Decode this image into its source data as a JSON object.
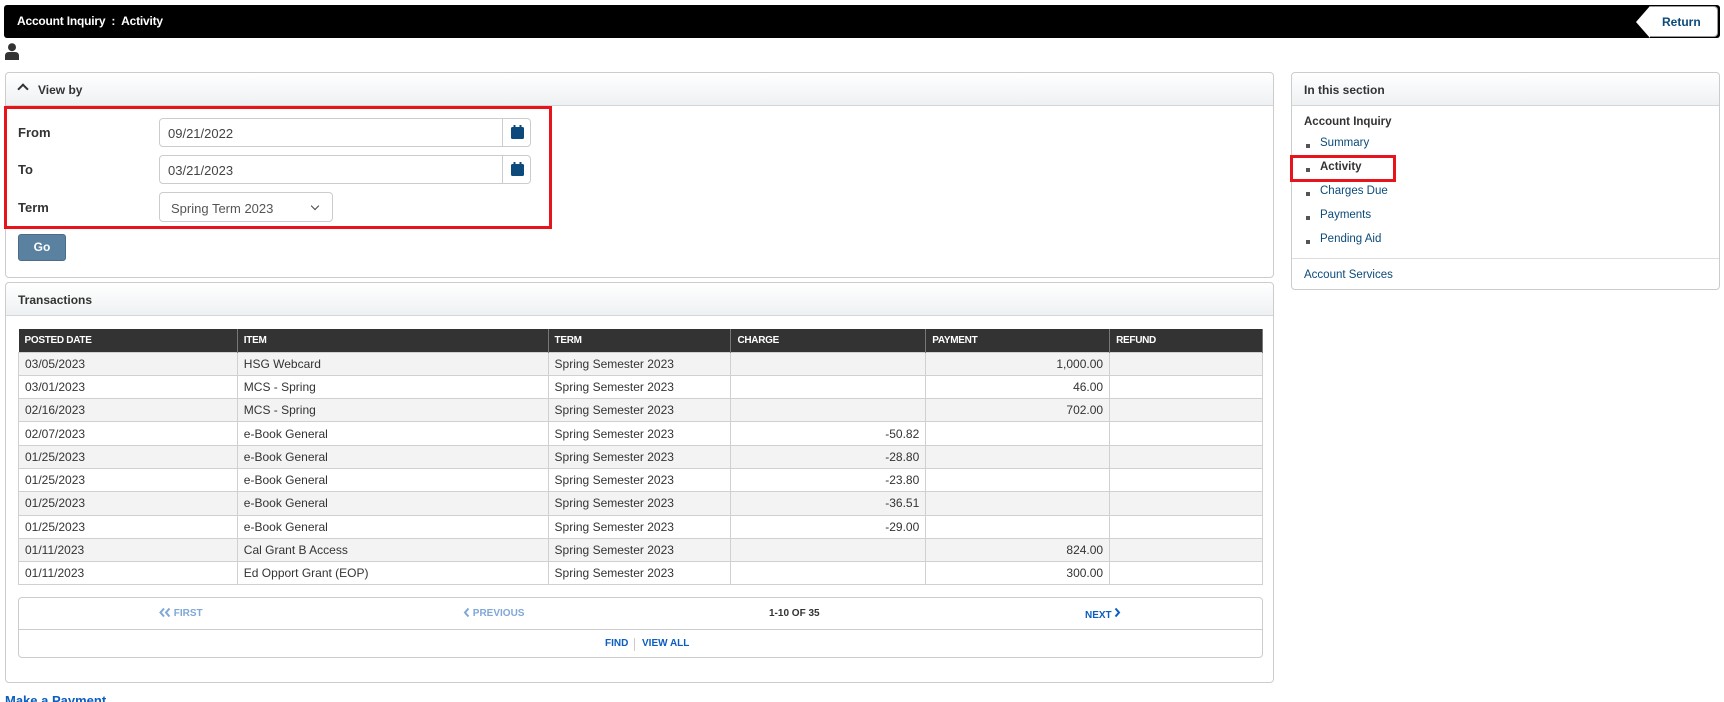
{
  "header": {
    "breadcrumb": [
      "Account Inquiry",
      "Activity"
    ],
    "separator": ":",
    "return_label": "Return"
  },
  "view_by": {
    "title": "View by",
    "from_label": "From",
    "from_value": "09/21/2022",
    "to_label": "To",
    "to_value": "03/21/2023",
    "term_label": "Term",
    "term_value": "Spring Term 2023",
    "go_label": "Go"
  },
  "transactions": {
    "title": "Transactions",
    "columns": [
      "POSTED DATE",
      "ITEM",
      "TERM",
      "CHARGE",
      "PAYMENT",
      "REFUND"
    ],
    "rows": [
      {
        "date": "03/05/2023",
        "item": "HSG Webcard",
        "term": "Spring Semester 2023",
        "charge": "",
        "payment": "1,000.00",
        "refund": ""
      },
      {
        "date": "03/01/2023",
        "item": "MCS - Spring",
        "term": "Spring Semester 2023",
        "charge": "",
        "payment": "46.00",
        "refund": ""
      },
      {
        "date": "02/16/2023",
        "item": "MCS - Spring",
        "term": "Spring Semester 2023",
        "charge": "",
        "payment": "702.00",
        "refund": ""
      },
      {
        "date": "02/07/2023",
        "item": "e-Book General",
        "term": "Spring Semester 2023",
        "charge": "-50.82",
        "payment": "",
        "refund": ""
      },
      {
        "date": "01/25/2023",
        "item": "e-Book General",
        "term": "Spring Semester 2023",
        "charge": "-28.80",
        "payment": "",
        "refund": ""
      },
      {
        "date": "01/25/2023",
        "item": "e-Book General",
        "term": "Spring Semester 2023",
        "charge": "-23.80",
        "payment": "",
        "refund": ""
      },
      {
        "date": "01/25/2023",
        "item": "e-Book General",
        "term": "Spring Semester 2023",
        "charge": "-36.51",
        "payment": "",
        "refund": ""
      },
      {
        "date": "01/25/2023",
        "item": "e-Book General",
        "term": "Spring Semester 2023",
        "charge": "-29.00",
        "payment": "",
        "refund": ""
      },
      {
        "date": "01/11/2023",
        "item": "Cal Grant B Access",
        "term": "Spring Semester 2023",
        "charge": "",
        "payment": "824.00",
        "refund": ""
      },
      {
        "date": "01/11/2023",
        "item": "Ed Opport Grant (EOP)",
        "term": "Spring Semester 2023",
        "charge": "",
        "payment": "300.00",
        "refund": ""
      }
    ],
    "pager": {
      "first_label": "FIRST",
      "previous_label": "PREVIOUS",
      "count_label": "1-10 OF 35",
      "next_label": "NEXT",
      "find_label": "FIND",
      "view_all_label": "VIEW ALL"
    }
  },
  "make_payment_label": "Make a Payment",
  "in_this_section": {
    "title": "In this section",
    "group_label": "Account Inquiry",
    "items": [
      {
        "label": "Summary",
        "current": false
      },
      {
        "label": "Activity",
        "current": true
      },
      {
        "label": "Charges Due",
        "current": false
      },
      {
        "label": "Payments",
        "current": false
      },
      {
        "label": "Pending Aid",
        "current": false
      }
    ],
    "services_label": "Account Services"
  },
  "colors": {
    "highlight": "#e8141b",
    "link": "#0b5dbf",
    "nav_link": "#0b4a7a",
    "go_button": "#5b81a1",
    "header_bar": "#000000",
    "table_header": "#333333"
  },
  "icons": {
    "user": "user-icon",
    "calendar": "calendar-icon",
    "collapse": "chevron-up-icon",
    "select_arrow": "chevron-down-icon",
    "first": "double-chevron-left-icon",
    "previous": "chevron-left-icon",
    "next": "chevron-right-icon"
  }
}
